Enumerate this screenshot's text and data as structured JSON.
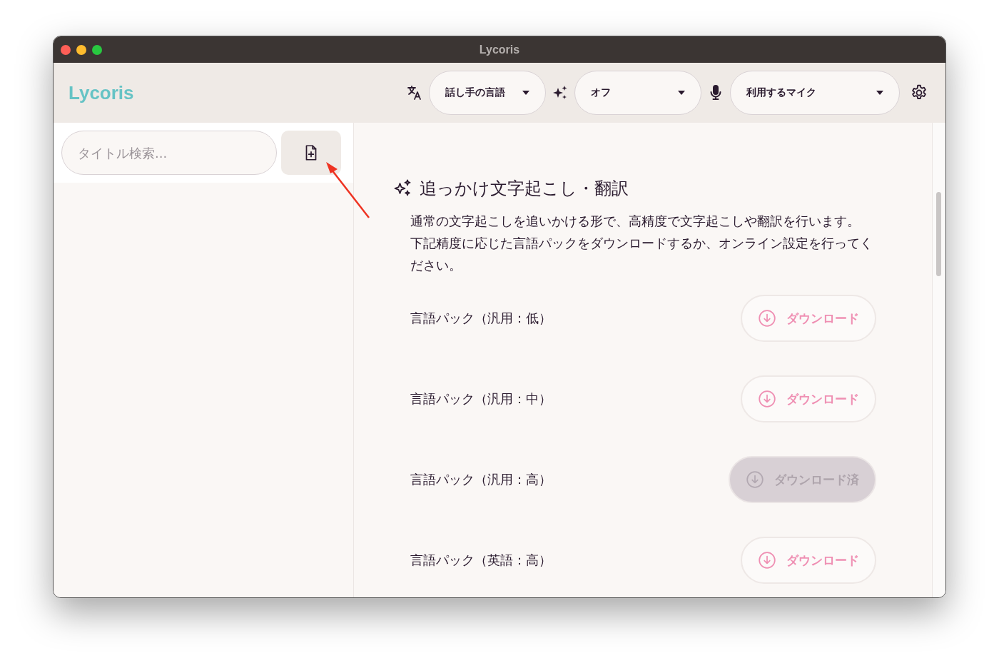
{
  "window": {
    "title": "Lycoris"
  },
  "header": {
    "logo": "Lycoris",
    "selects": [
      {
        "kind": "language",
        "value": "話し手の言語"
      },
      {
        "kind": "ai",
        "value": "オフ"
      },
      {
        "kind": "mic",
        "value": "利用するマイク"
      }
    ]
  },
  "sidebar": {
    "search": {
      "placeholder": "タイトル検索..."
    }
  },
  "section": {
    "title": "追っかけ文字起こし・翻訳",
    "description": [
      "通常の文字起こしを追いかける形で、高精度で文字起こしや翻訳を行います。",
      "下記精度に応じた言語パックをダウンロードするか、オンライン設定を行ってください。"
    ],
    "packs": [
      {
        "name": "言語パック（汎用：低）",
        "button": "ダウンロード",
        "downloaded": false
      },
      {
        "name": "言語パック（汎用：中）",
        "button": "ダウンロード",
        "downloaded": false
      },
      {
        "name": "言語パック（汎用：高）",
        "button": "ダウンロード済",
        "downloaded": true
      },
      {
        "name": "言語パック（英語：高）",
        "button": "ダウンロード",
        "downloaded": false
      }
    ]
  }
}
